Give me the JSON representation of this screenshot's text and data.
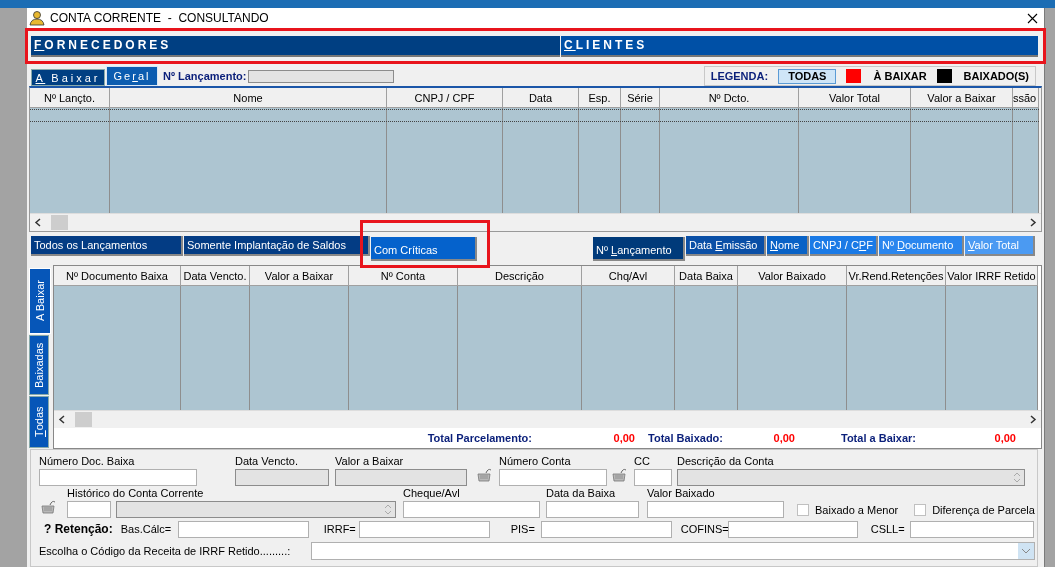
{
  "window": {
    "title": "CONTA CORRENTE  -  CONSULTANDO"
  },
  "entity_tabs": [
    {
      "key": "F",
      "after": "ORNECEDORES",
      "selected": false
    },
    {
      "key": "C",
      "after": "LIENTES",
      "selected": true
    }
  ],
  "view_tabs": [
    {
      "key": "A",
      "after": " Baixar",
      "selected": false
    },
    {
      "before": "Ge",
      "key": "r",
      "after": "al",
      "selected": true
    }
  ],
  "launch_filter": {
    "label": "Nº Lançamento:"
  },
  "legend": {
    "title": "LEGENDA:",
    "items": [
      {
        "kind": "button",
        "label": "TODAS",
        "selected": true
      },
      {
        "kind": "swatch",
        "label": "À BAIXAR",
        "color": "#ff0000"
      },
      {
        "kind": "swatch",
        "label": "BAIXADO(S)",
        "color": "#000000"
      }
    ]
  },
  "launch_table": {
    "columns": [
      "Nº Lançto.",
      "Nome",
      "CNPJ / CPF",
      "Data",
      "Esp.",
      "Série",
      "Nº Dcto.",
      "Valor Total",
      "Valor a Baixar",
      "ssão"
    ]
  },
  "filter_tabs": [
    {
      "label": "Todos os Lançamentos",
      "selected": false
    },
    {
      "label": "Somente Implantação de Saldos",
      "selected": false
    },
    {
      "label": "Com Críticas",
      "selected": true
    }
  ],
  "sort_tabs": [
    {
      "before": "Nº ",
      "key": "L",
      "after": "ançamento",
      "selected": true,
      "color": "#003a7a"
    },
    {
      "before": "Data ",
      "key": "E",
      "after": "missão",
      "selected": false,
      "color": "#0a4fa6"
    },
    {
      "key": "N",
      "after": "ome",
      "selected": false,
      "color": "#0862c6"
    },
    {
      "before": "CNPJ / C",
      "key": "P",
      "after": "F",
      "selected": false,
      "color": "#1a7ae6"
    },
    {
      "before": "Nº ",
      "key": "D",
      "after": "ocumento",
      "selected": false,
      "color": "#2a86ee"
    },
    {
      "key": "V",
      "after": "alor Total",
      "selected": false,
      "color": "#4b9af2"
    }
  ],
  "side_tabs": [
    {
      "label": "A Baixar",
      "selected": true
    },
    {
      "label": "Baixadas",
      "selected": false
    },
    {
      "key": "T",
      "after": "odas",
      "selected": false
    }
  ],
  "payment_table": {
    "columns": [
      "Nº Documento Baixa",
      "Data Vencto.",
      "Valor a Baixar",
      "Nº Conta",
      "Descrição",
      "Chq/Avl",
      "Data Baixa",
      "Valor Baixado",
      "Vr.Rend.Retenções",
      "Valor IRRF Retido"
    ]
  },
  "totals": [
    {
      "label": "Total Parcelamento:",
      "value": "0,00"
    },
    {
      "label": "Total Baixado:",
      "value": "0,00"
    },
    {
      "label": "Total a Baixar:",
      "value": "0,00"
    }
  ],
  "form": {
    "row1": [
      {
        "kind": "field",
        "label": "Número Doc. Baixa",
        "disabled": false
      },
      {
        "kind": "field",
        "label": "Data Vencto.",
        "disabled": true
      },
      {
        "kind": "field",
        "label": "Valor a Baixar",
        "disabled": true
      },
      {
        "kind": "lookup",
        "label": "Número Conta",
        "disabled": false
      },
      {
        "kind": "lookup",
        "label": "CC",
        "disabled": false
      },
      {
        "kind": "memo",
        "label": "Descrição da Conta",
        "disabled": true
      }
    ],
    "row2": [
      {
        "kind": "lookup_pair",
        "label": "Histórico do Conta Corrente",
        "disabled": true
      },
      {
        "kind": "field",
        "label": "Cheque/Avl",
        "disabled": false
      },
      {
        "kind": "field",
        "label": "Data da Baixa",
        "disabled": false
      },
      {
        "kind": "field",
        "label": "Valor Baixado",
        "disabled": false
      },
      {
        "kind": "checkbox",
        "label": "Baixado a Menor",
        "checked": false
      },
      {
        "kind": "checkbox",
        "label": "Diferença de Parcela",
        "checked": false
      }
    ],
    "retention": {
      "title": "? Retenção:",
      "fields": [
        "Bas.Cálc=",
        "IRRF=",
        "PIS=",
        "COFINS=",
        "CSLL="
      ]
    },
    "receipt_code": {
      "label": "Escolha o Código da Receita de IRRF Retido.........:"
    }
  }
}
